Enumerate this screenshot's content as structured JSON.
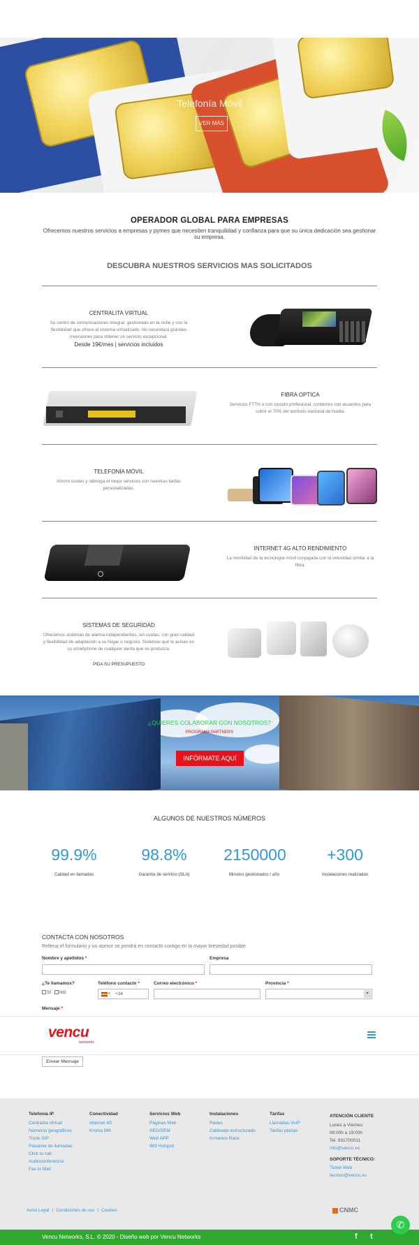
{
  "hero": {
    "title": "Telefonía Móvil",
    "button": "VER MÁS"
  },
  "intro": {
    "title": "OPERADOR GLOBAL PARA EMPRESAS",
    "text": "Ofrecemos nuestros servicios a empresas y pymes que necesiten tranquilidad y confianza para que su única dedicación sea gestionar su empresa.",
    "services_heading": "DESCUBRA NUESTROS SERVICIOS MAS SOLICITADOS"
  },
  "services": [
    {
      "title": "CENTRALITA VIRTUAL",
      "text": "Su centro de comunicaciones integral, gestionado en la nube y con la flexibilidad que ofrece el sistema virtualizado. No necesitará grandes inversiones para obtener un servicio excepcional.",
      "price": "Desde 19€/mes | servicios incluidos",
      "image": "desk-phone"
    },
    {
      "title": "FIBRA OPTICA",
      "text": "Servicios FTTH o con circuito profesional, contamos con acuerdos para cubrir el 70% del territorio nacional de huella.",
      "image": "router"
    },
    {
      "title": "TELEFONÍA MÓVIL",
      "text": "Ahorre costes y obtenga el mejor servicios con nuestras tarifas personalizadas.",
      "image": "smartphones"
    },
    {
      "title": "INTERNET 4G ALTO RENDIMIENTO",
      "text": "La movilidad de la tecnología móvil conjugada con la velocidad similar a la fibra.",
      "image": "4g-router"
    },
    {
      "title": "SISTEMAS DE SEGURIDAD",
      "text": "Ofrecemos sistemas de alarma independientes, sin cuotas, con gran calidad y flexibilidad de adaptación a su hogar o negocio. Sistemas que le avisan en su smartphone de cualquier alerta que se produzca.",
      "link": "PIDA SU PRESUPUESTO",
      "image": "alarm-sensors"
    }
  ],
  "cta": {
    "title": "¿QUIERES COLABORAR CON NOSOTROS?",
    "subtitle": "PROGRAMA PARTNERS",
    "button": "INFÓRMATE AQUÍ"
  },
  "numbers": {
    "title": "ALGUNOS DE NUESTROS NÚMEROS",
    "stats": [
      {
        "value": "99.9%",
        "label": "Calidad en llamadas"
      },
      {
        "value": "98.8%",
        "label": "Garantía de servicio (SLA)"
      },
      {
        "value": "2150000",
        "label": "Minutos gestionados / año"
      },
      {
        "value": "+300",
        "label": "Instalaciones realizadas"
      }
    ]
  },
  "contact": {
    "title": "CONTACTA CON NOSOTROS",
    "subtitle": "Rellena el formulario y un asesor se pondrá en contacto contigo en la mayor brevedad posible",
    "name_label": "Nombre y apellidos",
    "company_label": "Empresa",
    "call_label": "¿Te llamamos?",
    "yes": "SÍ",
    "no": "NO",
    "phone_label": "Teléfono contacto",
    "phone_prefix": "+34",
    "email_label": "Correo electrónico",
    "province_label": "Provincia",
    "message_label": "Mensaje",
    "required_mark": "*",
    "send_button": "Enviar Mensaje"
  },
  "header": {
    "logo": "vencu",
    "logo_sub": "networks"
  },
  "footer": {
    "columns": [
      {
        "title": "Telefonía IP",
        "links": [
          "Centralita Virtual",
          "Números geográficos",
          "Trunk SIP",
          "Pasarela de llamadas",
          "Click to call",
          "Audioconferencia",
          "Fax to Mail"
        ]
      },
      {
        "title": "Conectividad",
        "links": [
          "Internet 4G",
          "Kroma Mifi"
        ]
      },
      {
        "title": "Servicios Web",
        "links": [
          "Páginas Web",
          "SEO/SEM",
          "Web APP",
          "Wifi Hotspot"
        ]
      },
      {
        "title": "Instalaciones",
        "links": [
          "Redes",
          "Cableado estructurado",
          "Armarios Rack"
        ]
      },
      {
        "title": "Tárifas",
        "links": [
          "Llamadas VoIP",
          "Tarifas planas"
        ]
      }
    ],
    "attention": {
      "title": "ATENCIÓN CLIENTE",
      "hours1": "Lunes a Viernes:",
      "hours2": "09:00h a 19:00h",
      "phone": "Tel. 931700011",
      "email": "info@vencu.es"
    },
    "support": {
      "title": "SOPORTE TÉCNICO:",
      "link": "Ticket Web",
      "email": "tecnico@vencu.es"
    },
    "legal": [
      "Aviso Legal",
      "Condiciones de uso",
      "Cookies"
    ],
    "legal_sep": "|",
    "cnmc": "CNMC",
    "copyright": "Vencu Networks, S.L. © 2020 - Diseño web por Vencu Networks",
    "facebook": "f",
    "twitter": "t",
    "whatsapp": "✆"
  },
  "colors": {
    "accent": "#3596d6",
    "brand_red": "#d81920",
    "cta_green": "#29d14b",
    "footer_green": "#2ea82e"
  }
}
